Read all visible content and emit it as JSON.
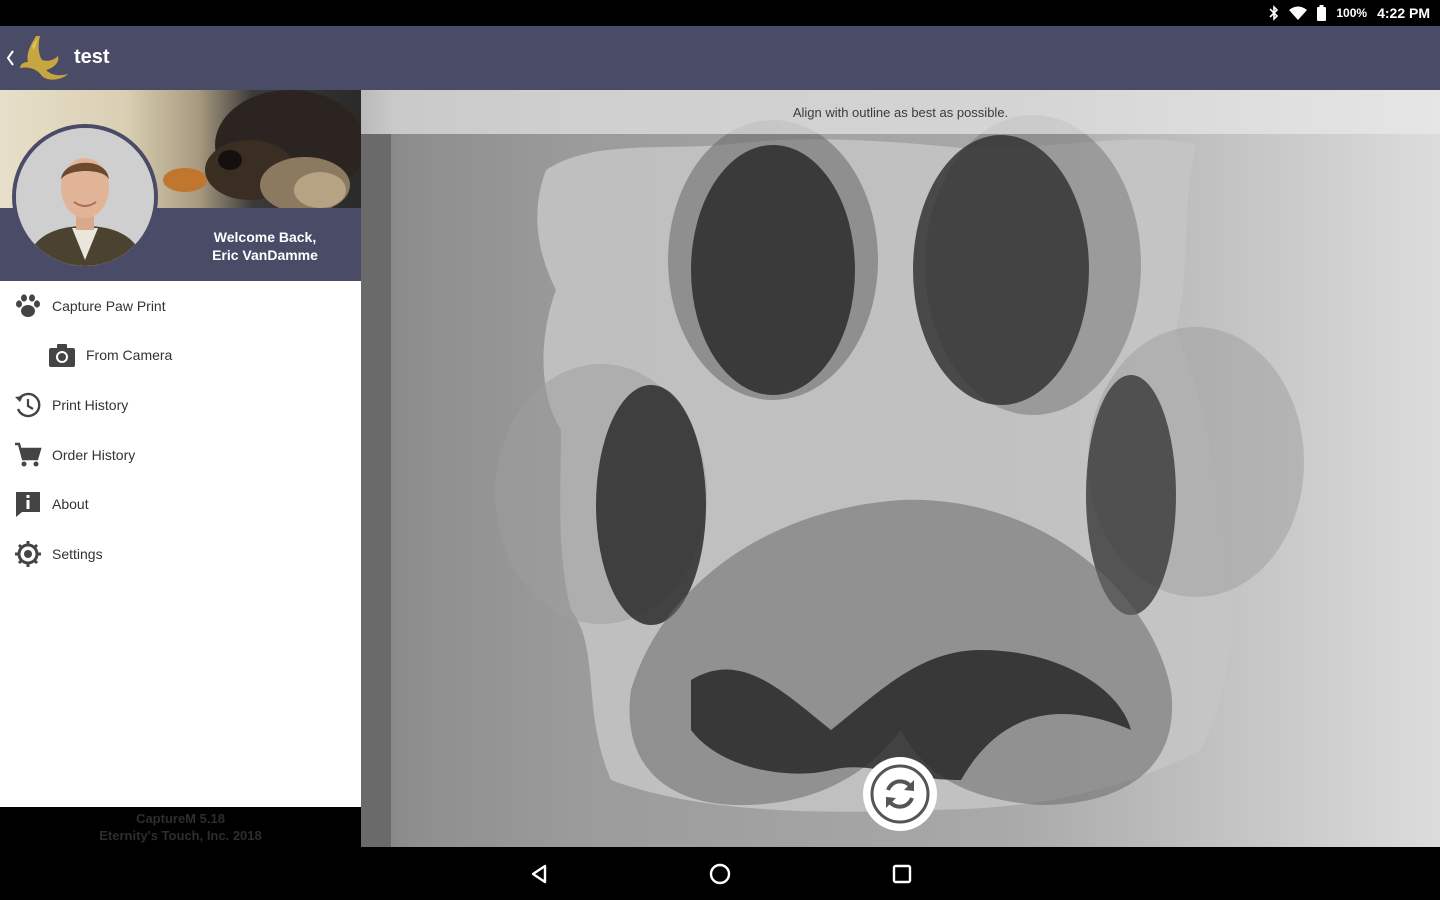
{
  "status_bar": {
    "battery": "100%",
    "time": "4:22 PM",
    "icons": [
      "bluetooth-icon",
      "wifi-icon",
      "battery-icon"
    ]
  },
  "app_bar": {
    "title": "test",
    "icons": [
      "back-chevron-icon",
      "app-logo-icon"
    ]
  },
  "drawer": {
    "welcome_line1": "Welcome Back,",
    "welcome_line2": "Eric VanDamme",
    "items": [
      {
        "label": "Capture Paw Print",
        "icon": "paw-icon"
      },
      {
        "label": "From Camera",
        "icon": "camera-icon"
      },
      {
        "label": "Print History",
        "icon": "history-icon"
      },
      {
        "label": "Order History",
        "icon": "cart-icon"
      },
      {
        "label": "About",
        "icon": "info-icon"
      },
      {
        "label": "Settings",
        "icon": "gear-icon"
      }
    ],
    "footer_line1": "CaptureM 5.18",
    "footer_line2": "Eternity's Touch, Inc. 2018"
  },
  "camera": {
    "hint": "Align with outline as best as possible.",
    "capture_icon": "switch-camera-icon"
  },
  "nav_bar": {
    "icons": [
      "back-triangle-icon",
      "home-circle-icon",
      "recents-square-icon"
    ]
  },
  "colors": {
    "primary": "#4a4b67",
    "accent_gold": "#c7a640"
  }
}
